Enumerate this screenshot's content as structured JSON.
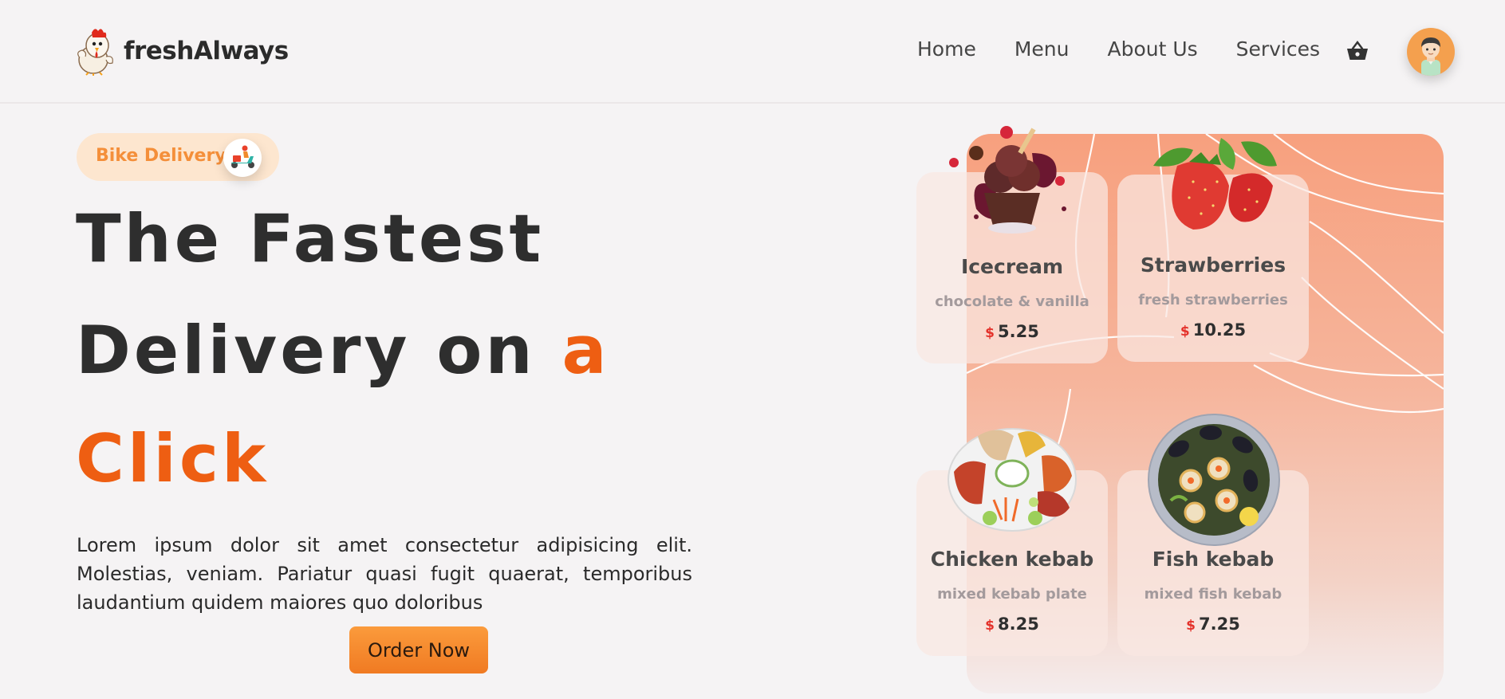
{
  "brand": {
    "name": "freshAlways",
    "logo_icon": "chicken-mascot-icon"
  },
  "nav": {
    "items": [
      {
        "label": "Home"
      },
      {
        "label": "Menu"
      },
      {
        "label": "About Us"
      },
      {
        "label": "Services"
      }
    ],
    "basket_icon": "basket-icon",
    "avatar_icon": "user-avatar-icon"
  },
  "hero": {
    "badge": {
      "label": "Bike Delivery",
      "icon": "scooter-rider-icon"
    },
    "headline": {
      "line1": "The Fastest",
      "line2": "Delivery on",
      "line2_accent": "a",
      "line3": "Click"
    },
    "description": "Lorem ipsum dolor sit amet consectetur adipisicing elit. Molestias, veniam. Pariatur quasi fugit quaerat, temporibus laudantium quidem maiores quo doloribus",
    "cta_label": "Order Now"
  },
  "menu_cards": [
    {
      "title": "Icecream",
      "subtitle": "chocolate & vanilla",
      "currency": "$",
      "price": "5.25",
      "icon": "icecream-icon"
    },
    {
      "title": "Strawberries",
      "subtitle": "fresh strawberries",
      "currency": "$",
      "price": "10.25",
      "icon": "strawberry-icon"
    },
    {
      "title": "Chicken kebab",
      "subtitle": "mixed kebab plate",
      "currency": "$",
      "price": "8.25",
      "icon": "kebab-plate-icon"
    },
    {
      "title": "Fish kebab",
      "subtitle": "mixed fish kebab",
      "currency": "$",
      "price": "7.25",
      "icon": "seafood-plate-icon"
    }
  ],
  "colors": {
    "accent": "#ee5e12",
    "badge_bg": "#fde6cf",
    "badge_text": "#f48f3a",
    "button": "#f58a2c",
    "price_currency": "#e4322b",
    "panel_top": "#f7a07e"
  }
}
